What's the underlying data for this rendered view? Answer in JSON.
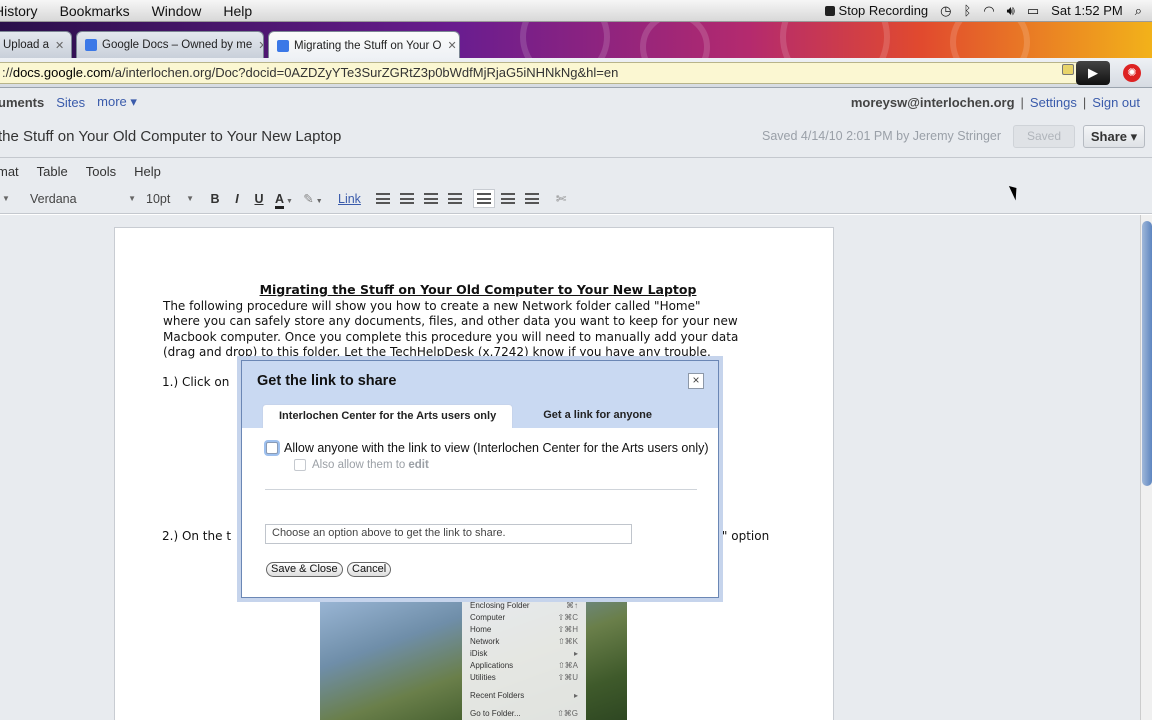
{
  "os_menu": {
    "items": [
      "History",
      "Bookmarks",
      "Window",
      "Help"
    ],
    "stop_recording": "Stop Recording",
    "clock": "Sat 1:52 PM"
  },
  "browser": {
    "tabs": [
      {
        "label": "Upload a",
        "active": false
      },
      {
        "label": "Google Docs – Owned by me",
        "active": false
      },
      {
        "label": "Migrating the Stuff on Your O",
        "active": true
      }
    ],
    "url_prefix": "://",
    "url_host": "docs.google.com",
    "url_rest": "/a/interlochen.org/Doc?docid=0AZDZyYTe3SurZGRtZ3p0bWdfMjRjaG5iNHNkNg&hl=en"
  },
  "docs_nav": {
    "documents": "uments",
    "sites": "Sites",
    "more": "more ▾",
    "email": "moreysw@interlochen.org",
    "settings": "Settings",
    "signout": "Sign out"
  },
  "doc_header": {
    "title": "the Stuff on Your Old Computer to Your New Laptop",
    "saved_text": "Saved 4/14/10 2:01 PM by Jeremy Stringer",
    "saved_button": "Saved",
    "share_button": "Share ▾"
  },
  "doc_menu": [
    "mat",
    "Table",
    "Tools",
    "Help"
  ],
  "toolbar": {
    "font": "Verdana",
    "size": "10pt",
    "bold": "B",
    "italic": "I",
    "underline": "U",
    "text_color": "A",
    "link": "Link"
  },
  "document": {
    "heading": "Migrating the Stuff on Your Old Computer to Your New Laptop",
    "intro_lines": [
      "The following procedure will show you how to create a new Network folder called \"Home\"",
      "where you can safely store any documents, files, and other data you want to keep for your new",
      "Macbook computer. Once you complete this procedure you will need to manually add your data",
      "(drag and drop) to this folder. Let the TechHelpDesk (x.7242) know if you have any trouble."
    ],
    "step1": "1.)  Click on",
    "step2_left": "2.)  On the t",
    "step2_right": "r\" option"
  },
  "finder_menu": {
    "items": [
      {
        "label": "Enclosing Folder",
        "key": "⌘↑"
      },
      {
        "label": "Computer",
        "key": "⇧⌘C"
      },
      {
        "label": "Home",
        "key": "⇧⌘H"
      },
      {
        "label": "Network",
        "key": "⇧⌘K"
      },
      {
        "label": "iDisk",
        "key": "▸"
      },
      {
        "label": "Applications",
        "key": "⇧⌘A"
      },
      {
        "label": "Utilities",
        "key": "⇧⌘U"
      },
      {
        "label": "Recent Folders",
        "key": "▸"
      },
      {
        "label": "Go to Folder...",
        "key": "⇧⌘G"
      }
    ]
  },
  "dialog": {
    "title": "Get the link to share",
    "close": "×",
    "tab_org": "Interlochen Center for the Arts users only",
    "tab_anyone": "Get a link for anyone",
    "allow_view": "Allow anyone with the link to view (Interlochen Center for the Arts users only)",
    "allow_edit_prefix": "Also allow them to ",
    "allow_edit_word": "edit",
    "link_placeholder": "Choose an option above to get the link to share.",
    "save_close": "Save & Close",
    "cancel": "Cancel"
  }
}
